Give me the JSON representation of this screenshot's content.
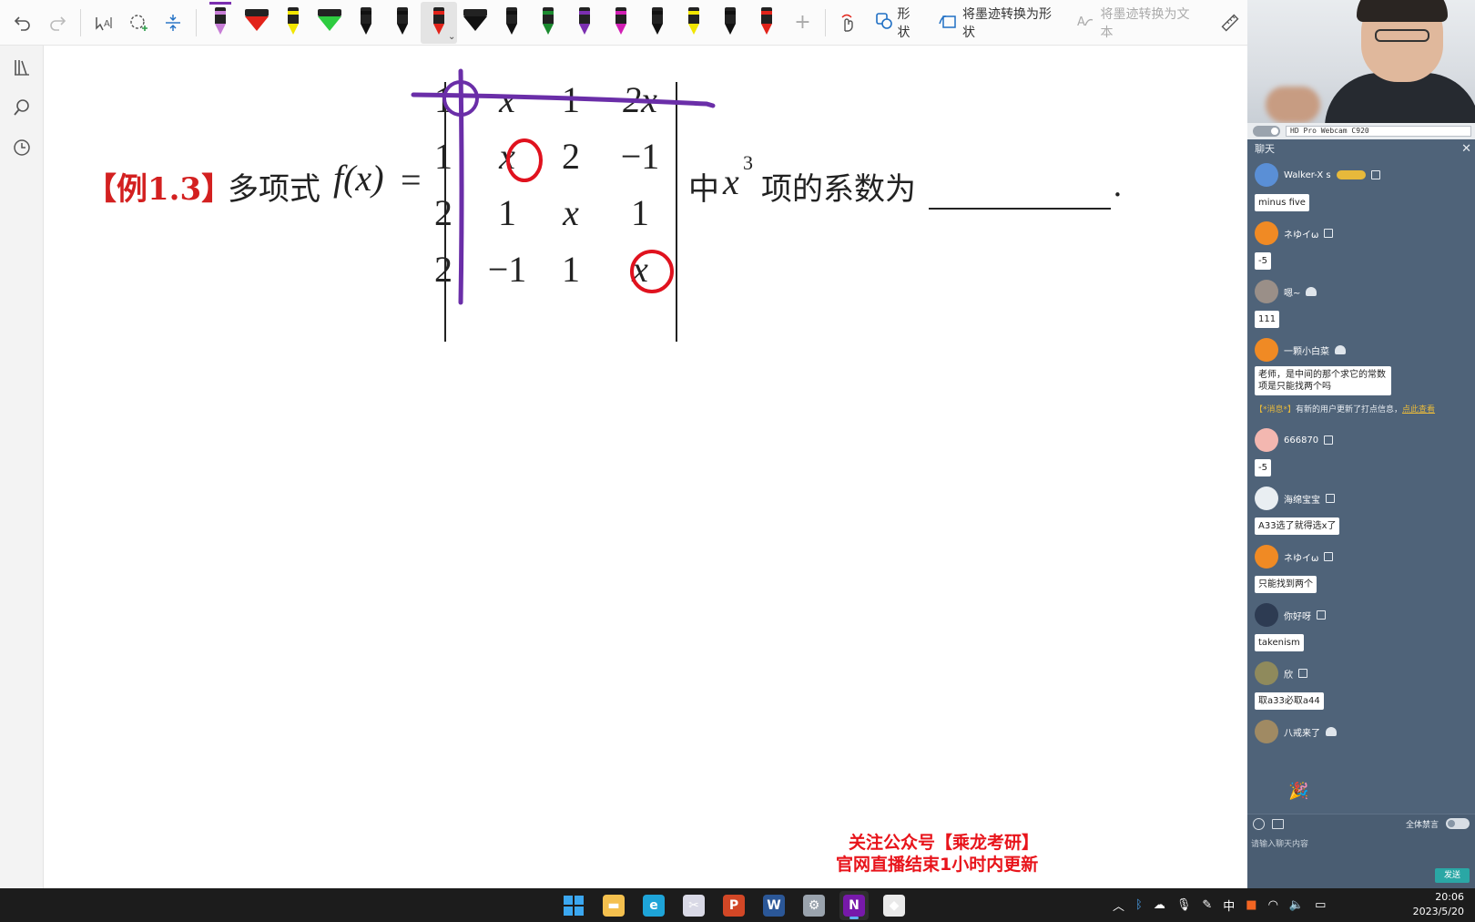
{
  "toolbar": {
    "icons": [
      "undo-icon",
      "redo-icon",
      "lasso-select-icon",
      "lasso-add-icon",
      "insert-space-icon",
      "touch-draw-icon",
      "ruler-icon"
    ],
    "pens": [
      {
        "type": "pen",
        "color": "#c77dd6",
        "band": "#222222"
      },
      {
        "type": "marker",
        "color": "#e2231a"
      },
      {
        "type": "pen",
        "color": "#f2e600"
      },
      {
        "type": "marker",
        "color": "#2ecc40"
      },
      {
        "type": "pen",
        "color": "#111111"
      },
      {
        "type": "pen",
        "color": "#111111",
        "band": "#ffffff"
      },
      {
        "type": "pen",
        "color": "#e2231a",
        "selected": true
      },
      {
        "type": "marker",
        "color": "#111111"
      },
      {
        "type": "pen",
        "color": "#111111"
      },
      {
        "type": "pen",
        "color": "#1b8a2f"
      },
      {
        "type": "pen",
        "color": "#7b2fb0"
      },
      {
        "type": "pen",
        "color": "#d21fb4"
      },
      {
        "type": "pen",
        "color": "#111111"
      },
      {
        "type": "pen",
        "color": "#f2e600"
      },
      {
        "type": "pen",
        "color": "#111111"
      },
      {
        "type": "pen",
        "color": "#e2231a"
      }
    ],
    "add_pen_label": "+",
    "shapes_label": "形状",
    "ink_to_shape_label": "将墨迹转换为形状",
    "ink_to_text_label": "将墨迹转换为文本"
  },
  "left_rail": {
    "items": [
      "notebooks-icon",
      "search-icon",
      "history-icon"
    ]
  },
  "canvas": {
    "example_tag": "【例1.3】",
    "lead_text": "多项式",
    "function": "f(x)",
    "equals": "=",
    "middle_text": "中",
    "term_var": "x",
    "term_exp": "3",
    "tail_text": "项的系数为",
    "period": ".",
    "matrix": [
      [
        "1",
        "x",
        "1",
        "2x"
      ],
      [
        "1",
        "x",
        "2",
        "−1"
      ],
      [
        "2",
        "1",
        "x",
        "1"
      ],
      [
        "2",
        "−1",
        "1",
        "x"
      ]
    ],
    "ink_colors": {
      "purple": "#6a2ea8",
      "red": "#e0121e"
    },
    "watermark": {
      "line1": "关注公众号【乘龙考研】",
      "line2": "官网直播结束1小时内更新"
    }
  },
  "webcam": {
    "device": "HD Pro Webcam C920"
  },
  "chat": {
    "title": "聊天",
    "messages": [
      {
        "user": "Walker-X s",
        "avatar_color": "#5a8fd6",
        "badge": true,
        "text": "minus five"
      },
      {
        "user": "ネゆイω",
        "avatar_color": "#f08a24",
        "text": "-5"
      },
      {
        "user": "嗯~",
        "avatar_color": "#9a8f88",
        "android": true,
        "text": "111"
      },
      {
        "user": "一颗小白菜",
        "avatar_color": "#f08a24",
        "android": true,
        "text": "老师，是中间的那个求它的常数项是只能找两个吗"
      },
      {
        "system": true,
        "tag": "【*消息*】",
        "text": "有新的用户更新了打点信息，",
        "link": "点此查看"
      },
      {
        "user": "666870",
        "avatar_color": "#f3b7b0",
        "text": "-5"
      },
      {
        "user": "海绵宝宝",
        "avatar_color": "#e9eef2",
        "text": "A33选了就得选x了"
      },
      {
        "user": "ネゆイω",
        "avatar_color": "#f08a24",
        "text": "只能找到两个"
      },
      {
        "user": "你好呀",
        "avatar_color": "#2d3b52",
        "text": "takenism"
      },
      {
        "user": "欣",
        "avatar_color": "#8f8a5c",
        "text": "取a33必取a44"
      },
      {
        "user": "八戒来了",
        "avatar_color": "#a08a63",
        "android": true
      }
    ],
    "input_placeholder": "请输入聊天内容",
    "mute_all_label": "全体禁言",
    "send_label": "发送"
  },
  "taskbar": {
    "apps": [
      {
        "name": "start-icon",
        "color": "#3ba7f0"
      },
      {
        "name": "file-explorer-icon",
        "color": "#f4c04e",
        "glyph": "▬"
      },
      {
        "name": "edge-icon",
        "color": "#1ea4d8",
        "glyph": "e"
      },
      {
        "name": "snipping-tool-icon",
        "color": "#d9d9e6",
        "glyph": "✂"
      },
      {
        "name": "powerpoint-icon",
        "color": "#d24726",
        "glyph": "P"
      },
      {
        "name": "word-icon",
        "color": "#2b5797",
        "glyph": "W"
      },
      {
        "name": "settings-icon",
        "color": "#9aa3ad",
        "glyph": "⚙"
      },
      {
        "name": "onenote-icon",
        "color": "#7719aa",
        "glyph": "N",
        "active": true
      },
      {
        "name": "capture-app-icon",
        "color": "#e9e9e9",
        "glyph": "◆"
      }
    ],
    "ime": "中",
    "time": "20:06",
    "date": "2023/5/20"
  }
}
